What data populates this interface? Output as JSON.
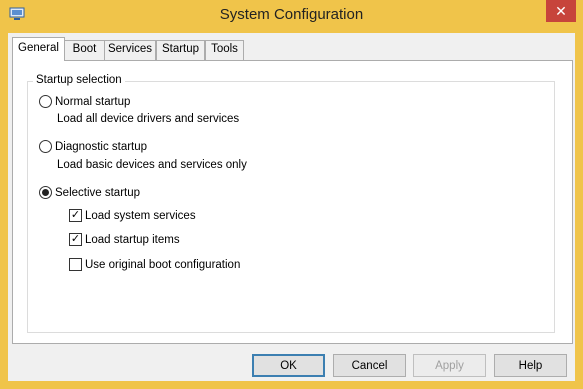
{
  "window": {
    "title": "System Configuration",
    "close_label": "✕",
    "app_icon": "msconfig-icon"
  },
  "tabs": [
    {
      "label": "General",
      "active": true
    },
    {
      "label": "Boot",
      "active": false
    },
    {
      "label": "Services",
      "active": false
    },
    {
      "label": "Startup",
      "active": false
    },
    {
      "label": "Tools",
      "active": false
    }
  ],
  "startup_selection": {
    "legend": "Startup selection",
    "normal": {
      "label": "Normal startup",
      "description": "Load all device drivers and services",
      "selected": false
    },
    "diagnostic": {
      "label": "Diagnostic startup",
      "description": "Load basic devices and services only",
      "selected": false
    },
    "selective": {
      "label": "Selective startup",
      "selected": true,
      "options": [
        {
          "label": "Load system services",
          "checked": true
        },
        {
          "label": "Load startup items",
          "checked": true
        },
        {
          "label": "Use original boot configuration",
          "checked": false
        }
      ]
    }
  },
  "buttons": {
    "ok": "OK",
    "cancel": "Cancel",
    "apply": "Apply",
    "help": "Help"
  }
}
